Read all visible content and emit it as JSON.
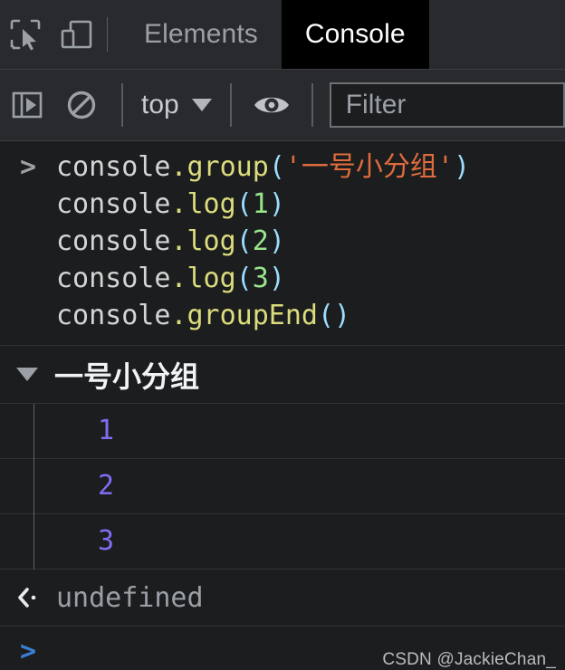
{
  "tabbar": {
    "inspect_icon": "inspect-element-icon",
    "device_icon": "device-toolbar-icon",
    "tabs": [
      {
        "label": "Elements",
        "active": false
      },
      {
        "label": "Console",
        "active": true
      }
    ]
  },
  "console_toolbar": {
    "sidebar_icon": "console-sidebar-icon",
    "clear_icon": "clear-console-icon",
    "context_label": "top",
    "context_caret_icon": "chevron-down-icon",
    "eye_icon": "live-expression-eye-icon",
    "filter_placeholder": "Filter"
  },
  "console": {
    "prompt_chevron": ">",
    "command_lines": [
      {
        "tokens": [
          {
            "text": "console",
            "type": "obj"
          },
          {
            "text": ".group",
            "type": "fn"
          },
          {
            "text": "(",
            "type": "paren"
          },
          {
            "text": "'一号小分组'",
            "type": "str"
          },
          {
            "text": ")",
            "type": "paren"
          }
        ]
      },
      {
        "tokens": [
          {
            "text": "console",
            "type": "obj"
          },
          {
            "text": ".log",
            "type": "fn"
          },
          {
            "text": "(",
            "type": "paren"
          },
          {
            "text": "1",
            "type": "num"
          },
          {
            "text": ")",
            "type": "paren"
          }
        ]
      },
      {
        "tokens": [
          {
            "text": "console",
            "type": "obj"
          },
          {
            "text": ".log",
            "type": "fn"
          },
          {
            "text": "(",
            "type": "paren"
          },
          {
            "text": "2",
            "type": "num"
          },
          {
            "text": ")",
            "type": "paren"
          }
        ]
      },
      {
        "tokens": [
          {
            "text": "console",
            "type": "obj"
          },
          {
            "text": ".log",
            "type": "fn"
          },
          {
            "text": "(",
            "type": "paren"
          },
          {
            "text": "3",
            "type": "num"
          },
          {
            "text": ")",
            "type": "paren"
          }
        ]
      },
      {
        "tokens": [
          {
            "text": "console",
            "type": "obj"
          },
          {
            "text": ".groupEnd",
            "type": "fn"
          },
          {
            "text": "()",
            "type": "paren"
          }
        ]
      }
    ],
    "group": {
      "title": "一号小分组",
      "expanded": true,
      "caret_icon": "caret-down-icon",
      "entries": [
        "1",
        "2",
        "3"
      ]
    },
    "result": {
      "arrow_icon": "return-value-arrow-icon",
      "value": "undefined"
    },
    "input_prompt_chevron": ">",
    "watermark": "CSDN @JackieChan_"
  },
  "colors": {
    "tabbar_bg": "#292a2d",
    "active_tab_bg": "#000000",
    "console_bg": "#1b1d1e",
    "string_orange": "#e06c3c",
    "function_yellow": "#dcdc7d",
    "number_green": "#9ae58c",
    "log_value_purple": "#7f6df2",
    "prompt_blue": "#3b7fd4"
  }
}
